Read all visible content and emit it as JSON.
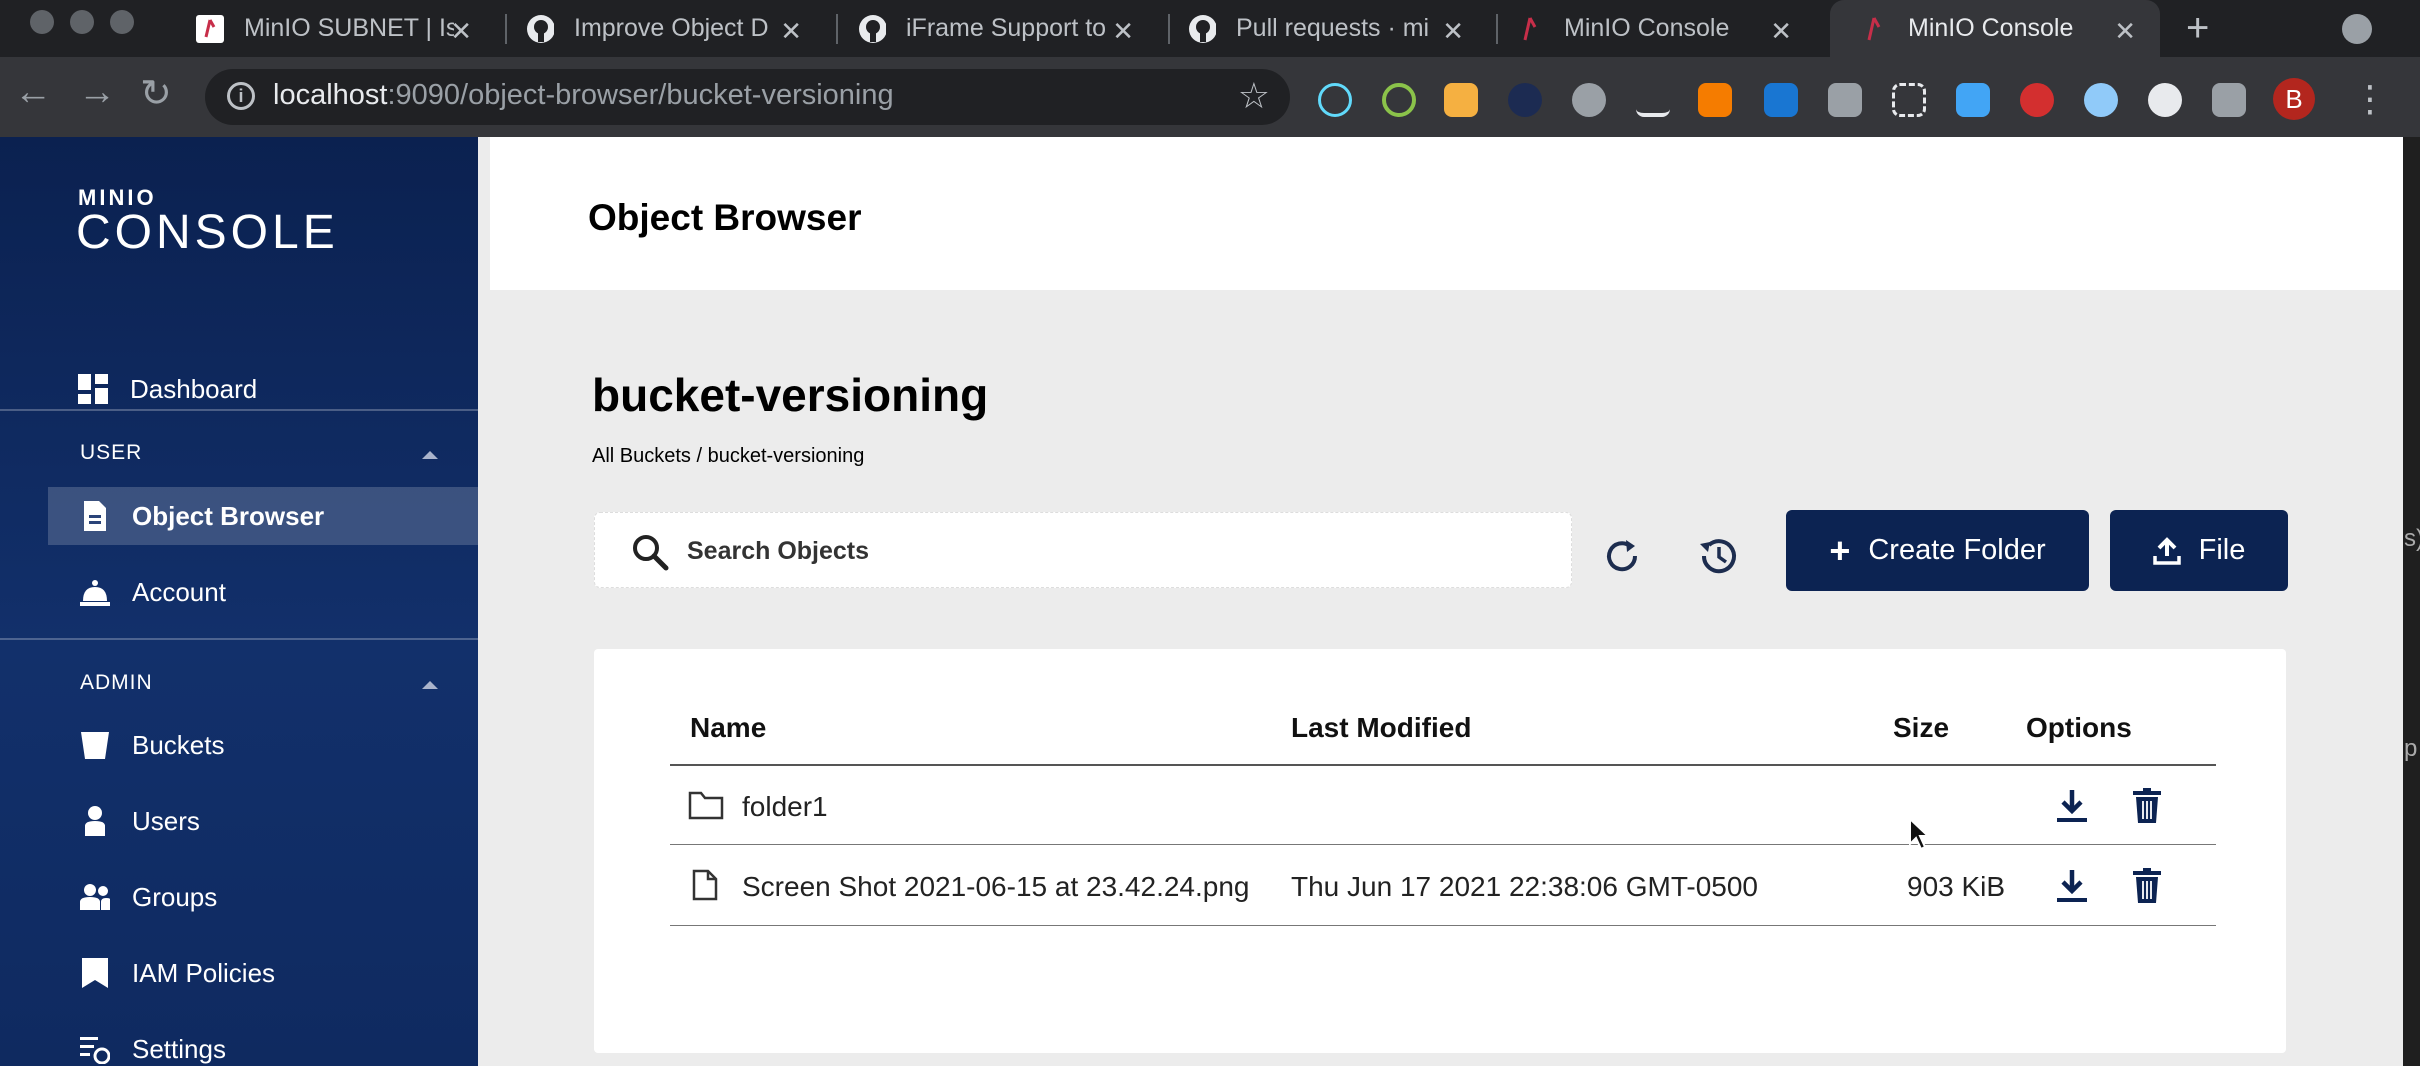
{
  "browser": {
    "tabs": [
      {
        "title": "MinIO SUBNET | Is"
      },
      {
        "title": "Improve Object D"
      },
      {
        "title": "iFrame Support to"
      },
      {
        "title": "Pull requests · mi"
      },
      {
        "title": "MinIO Console"
      },
      {
        "title": "MinIO Console"
      }
    ],
    "url_host": "localhost",
    "url_rest": ":9090/object-browser/bucket-versioning",
    "profile_initial": "B"
  },
  "sidebar": {
    "logo_small": "MINIO",
    "logo_big": "CONSOLE",
    "dashboard": "Dashboard",
    "user_section": "USER",
    "object_browser": "Object Browser",
    "account": "Account",
    "admin_section": "ADMIN",
    "buckets": "Buckets",
    "users": "Users",
    "groups": "Groups",
    "iam_policies": "IAM Policies",
    "settings": "Settings"
  },
  "header": {
    "title": "Object Browser"
  },
  "bucket": {
    "name": "bucket-versioning",
    "breadcrumb": "All Buckets / bucket-versioning"
  },
  "search": {
    "placeholder": "Search Objects"
  },
  "actions": {
    "create_folder": "Create Folder",
    "upload_file": "File"
  },
  "table": {
    "columns": [
      "Name",
      "Last Modified",
      "Size",
      "Options"
    ],
    "rows": [
      {
        "type": "folder",
        "name": "folder1",
        "last_modified": "",
        "size": ""
      },
      {
        "type": "file",
        "name": "Screen Shot 2021-06-15 at 23.42.24.png",
        "last_modified": "Thu Jun 17 2021 22:38:06 GMT-0500",
        "size": "903 KiB"
      }
    ]
  },
  "colors": {
    "sidebar_top": "#0b2150",
    "primary_button": "#0c2352",
    "main_background": "#ececec"
  }
}
